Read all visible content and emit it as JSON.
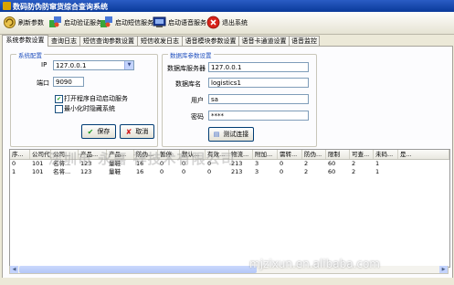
{
  "window": {
    "title": "数码防伪防窜货综合查询系统"
  },
  "toolbar": {
    "items": [
      {
        "label": "刷新参数",
        "icon": "refresh-icon"
      },
      {
        "label": "启动验证服务",
        "icon": "puzzle-icon"
      },
      {
        "label": "启动短信服务",
        "icon": "puzzle-icon"
      },
      {
        "label": "启动语音服务",
        "icon": "phone-icon"
      },
      {
        "label": "退出系统",
        "icon": "exit-icon"
      }
    ]
  },
  "tabs": [
    "系统参数设置",
    "查询日志",
    "短信查询参数设置",
    "短信收发日志",
    "语音模块参数设置",
    "语音卡通道设置",
    "语音监控"
  ],
  "system_config": {
    "title": "系统配置",
    "ip_label": "IP",
    "ip_value": "127.0.0.1",
    "port_label": "端口",
    "port_value": "9090",
    "auto_start_label": "打开程序自动启动服务",
    "auto_start_checked": true,
    "minimize_label": "最小化时隐藏系统",
    "minimize_checked": false,
    "save_label": "保存",
    "cancel_label": "取消"
  },
  "db_config": {
    "title": "数据库参数设置",
    "server_label": "数据库服务器",
    "server_value": "127.0.0.1",
    "dbname_label": "数据库名",
    "dbname_value": "logistics1",
    "user_label": "用户",
    "user_value": "sa",
    "password_label": "密码",
    "password_value": "****",
    "test_label": "测试连接"
  },
  "grid": {
    "columns": [
      "序...",
      "公司代码",
      "公司...",
      "产品...",
      "产品...",
      "防伪...",
      "暂停",
      "默认...",
      "有效...",
      "物流...",
      "附加...",
      "需转...",
      "防伪...",
      "限制",
      "可查...",
      "未码...",
      "是..."
    ],
    "rows": [
      [
        "0",
        "101",
        "名将...",
        "123",
        "量鞋",
        "16",
        "0",
        "0",
        "0",
        "213",
        "3",
        "0",
        "2",
        "60",
        "2",
        "1",
        ""
      ],
      [
        "1",
        "101",
        "名将...",
        "123",
        "量鞋",
        "16",
        "0",
        "0",
        "0",
        "213",
        "3",
        "0",
        "2",
        "60",
        "2",
        "1",
        ""
      ]
    ]
  },
  "watermarks": {
    "center": "深圳市  永嘉  祥技术有限公司",
    "bottom": "mjzixun.en.alibaba.com"
  }
}
